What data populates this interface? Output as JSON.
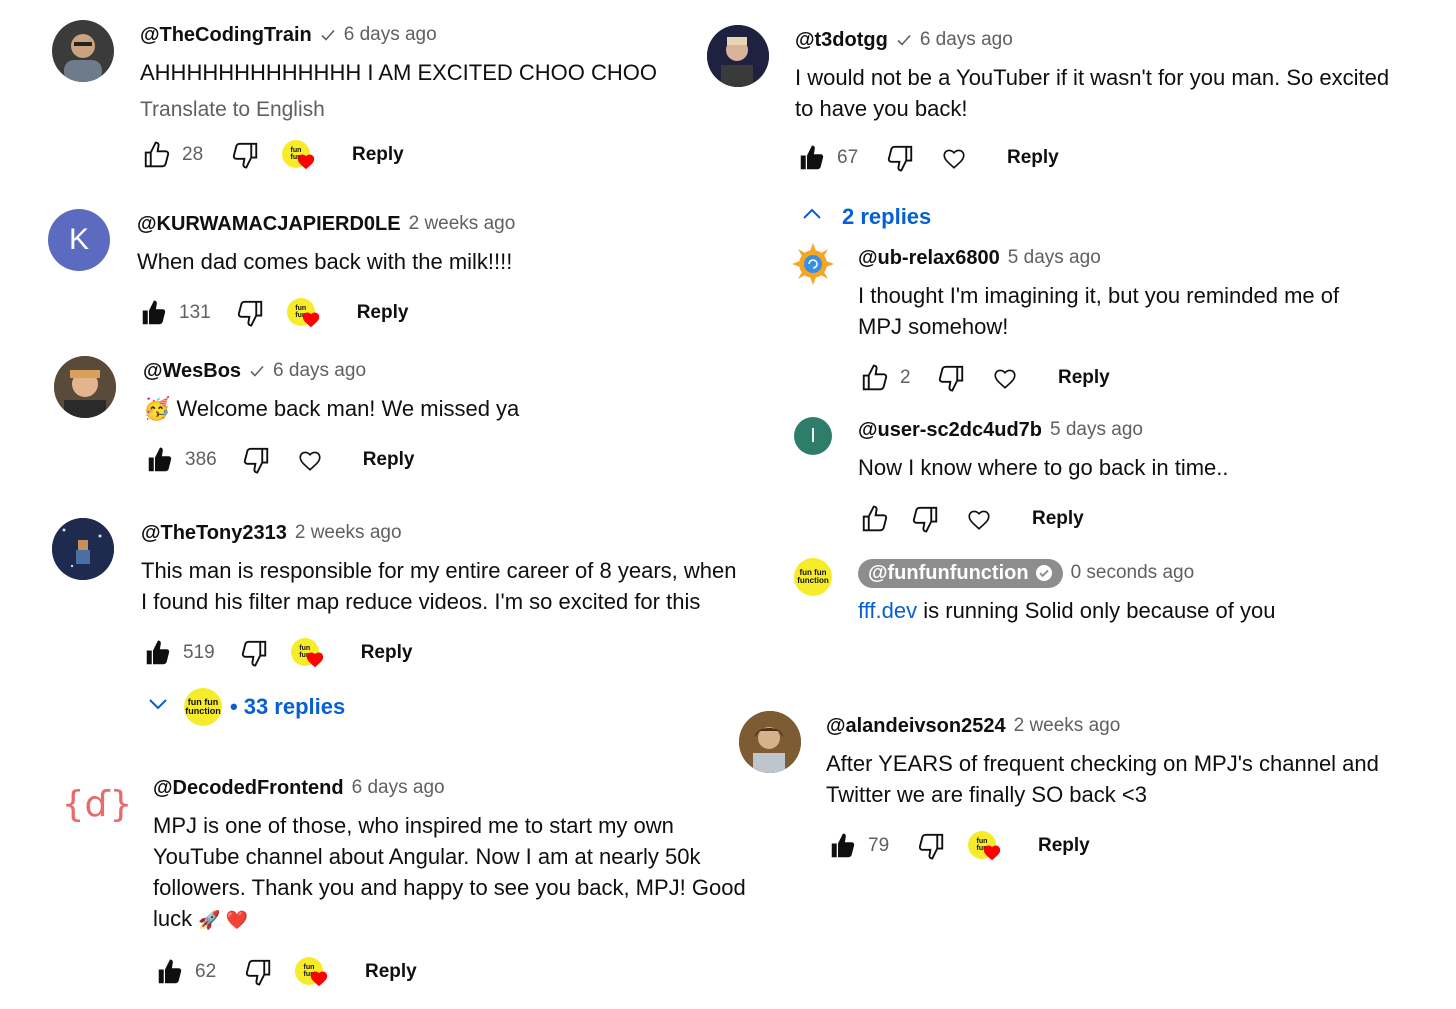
{
  "comments_left": [
    {
      "handle": "@TheCodingTrain",
      "verified": true,
      "time": "6 days ago",
      "text": "AHHHHHHHHHHHHH I AM EXCITED CHOO CHOO",
      "translate": "Translate to English",
      "likes": "28",
      "reply": "Reply",
      "liked": false,
      "heart": "badge"
    },
    {
      "handle": "@KURWAMACJAPIERD0LE",
      "verified": false,
      "time": "2 weeks ago",
      "text": "When dad comes back with the milk!!!!",
      "likes": "131",
      "reply": "Reply",
      "liked": true,
      "heart": "badge",
      "avatar_letter": "K"
    },
    {
      "handle": "@WesBos",
      "verified": true,
      "time": "6 days ago",
      "emoji": "🥳",
      "text": "Welcome back man! We missed ya",
      "likes": "386",
      "reply": "Reply",
      "liked": true,
      "heart": "outline"
    },
    {
      "handle": "@TheTony2313",
      "verified": false,
      "time": "2 weeks ago",
      "text_lines": [
        "This man is responsible for my entire career of 8 years, when",
        "I found his filter map reduce videos. I'm so excited for this"
      ],
      "likes": "519",
      "reply": "Reply",
      "liked": true,
      "heart": "badge",
      "replies": "33 replies"
    },
    {
      "handle": "@DecodedFrontend",
      "verified": false,
      "time": "6 days ago",
      "text_lines": [
        "MPJ is one of those, who inspired me to start my own",
        "YouTube channel about Angular. Now I am at nearly 50k",
        "followers. Thank you and happy to see you back, MPJ! Good",
        "luck"
      ],
      "text_emoji": "🚀 ❤️",
      "likes": "62",
      "reply": "Reply",
      "liked": true,
      "heart": "badge",
      "avatar_glyph": "{ɗ}"
    }
  ],
  "comments_right": [
    {
      "handle": "@t3dotgg",
      "verified": true,
      "time": "6 days ago",
      "text_lines": [
        "I would not be a YouTuber if it wasn't for you man. So excited",
        "to have you back!"
      ],
      "likes": "67",
      "reply": "Reply",
      "liked": true,
      "heart": "outline",
      "replies": "2 replies"
    },
    {
      "handle": "@ub-relax6800",
      "time": "5 days ago",
      "text_lines": [
        "I thought I'm imagining it, but you reminded me of",
        "MPJ somehow!"
      ],
      "likes": "2",
      "reply": "Reply",
      "liked": false,
      "heart": "outline"
    },
    {
      "handle": "@user-sc2dc4ud7b",
      "time": "5 days ago",
      "text": "Now I know where to go back in time..",
      "reply": "Reply",
      "liked": false,
      "heart": "outline",
      "avatar_letter": "I"
    },
    {
      "handle": "@funfunfunction",
      "time": "0 seconds ago",
      "link": "fff.dev",
      "text": " is running Solid only because of you"
    },
    {
      "handle": "@alandeivson2524",
      "time": "2 weeks ago",
      "text_lines": [
        "After YEARS of frequent checking on MPJ's channel and",
        "Twitter we are finally SO back <3"
      ],
      "likes": "79",
      "reply": "Reply",
      "liked": true,
      "heart": "badge"
    }
  ],
  "badge_logo_text": "fun fun function",
  "colors": {
    "link": "#065fd4",
    "heart": "#ff0000",
    "logo_yellow": "#f7ec2a",
    "k_avatar": "#5c6bc0",
    "i_avatar": "#2e7d6b",
    "muted": "#606060"
  }
}
